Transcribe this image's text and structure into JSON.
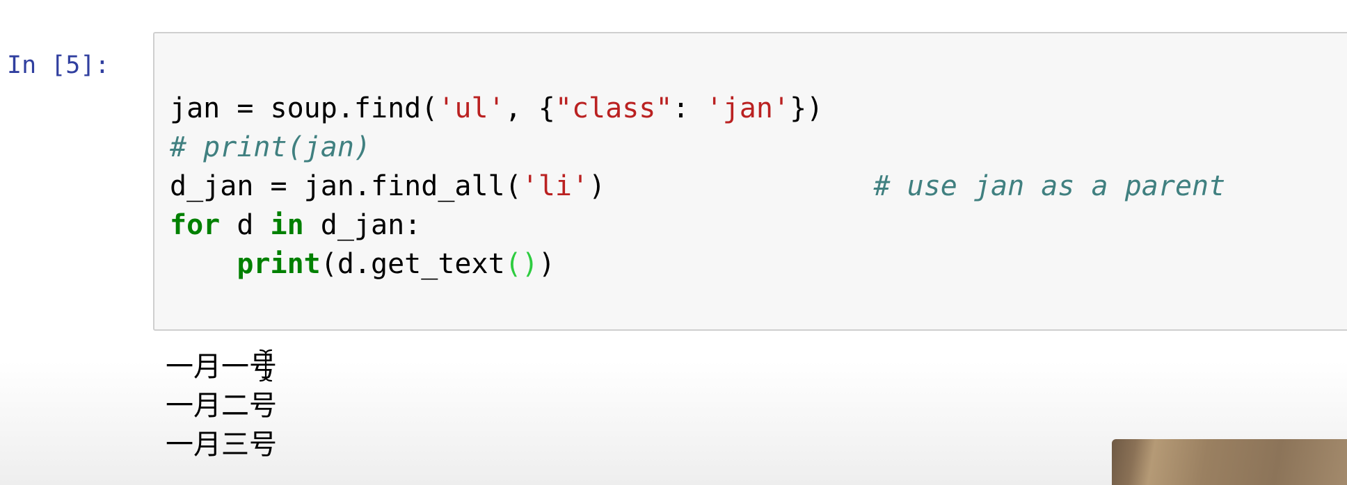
{
  "cell": {
    "prompt": "In [5]:",
    "code_lines": [
      [
        {
          "t": "jan = soup.find(",
          "k": "plain"
        },
        {
          "t": "'ul'",
          "k": "str"
        },
        {
          "t": ", {",
          "k": "plain"
        },
        {
          "t": "\"class\"",
          "k": "str"
        },
        {
          "t": ": ",
          "k": "plain"
        },
        {
          "t": "'jan'",
          "k": "str"
        },
        {
          "t": "})",
          "k": "plain"
        }
      ],
      [
        {
          "t": "# print(jan)",
          "k": "comment"
        }
      ],
      [
        {
          "t": "d_jan = jan.find_all(",
          "k": "plain"
        },
        {
          "t": "'li'",
          "k": "str"
        },
        {
          "t": ")                ",
          "k": "plain"
        },
        {
          "t": "# use jan as a parent",
          "k": "comment"
        }
      ],
      [
        {
          "t": "for",
          "k": "kw"
        },
        {
          "t": " d ",
          "k": "plain"
        },
        {
          "t": "in",
          "k": "kw"
        },
        {
          "t": " d_jan:",
          "k": "plain"
        }
      ],
      [
        {
          "t": "    ",
          "k": "plain"
        },
        {
          "t": "print",
          "k": "kw"
        },
        {
          "t": "(d.get_text",
          "k": "plain"
        },
        {
          "t": "()",
          "k": "paren-match"
        },
        {
          "t": ")",
          "k": "plain"
        }
      ]
    ],
    "output_lines": [
      "一月一号",
      "一月二号",
      "一月三号"
    ]
  },
  "icons": {
    "text_cursor": "text-cursor-icon"
  },
  "colors": {
    "prompt": "#303f9f",
    "string": "#ba2121",
    "comment": "#408080",
    "keyword": "#008000",
    "matched_paren": "#2ecc40",
    "cell_background": "#f7f7f7",
    "cell_border": "#cfcfcf"
  }
}
